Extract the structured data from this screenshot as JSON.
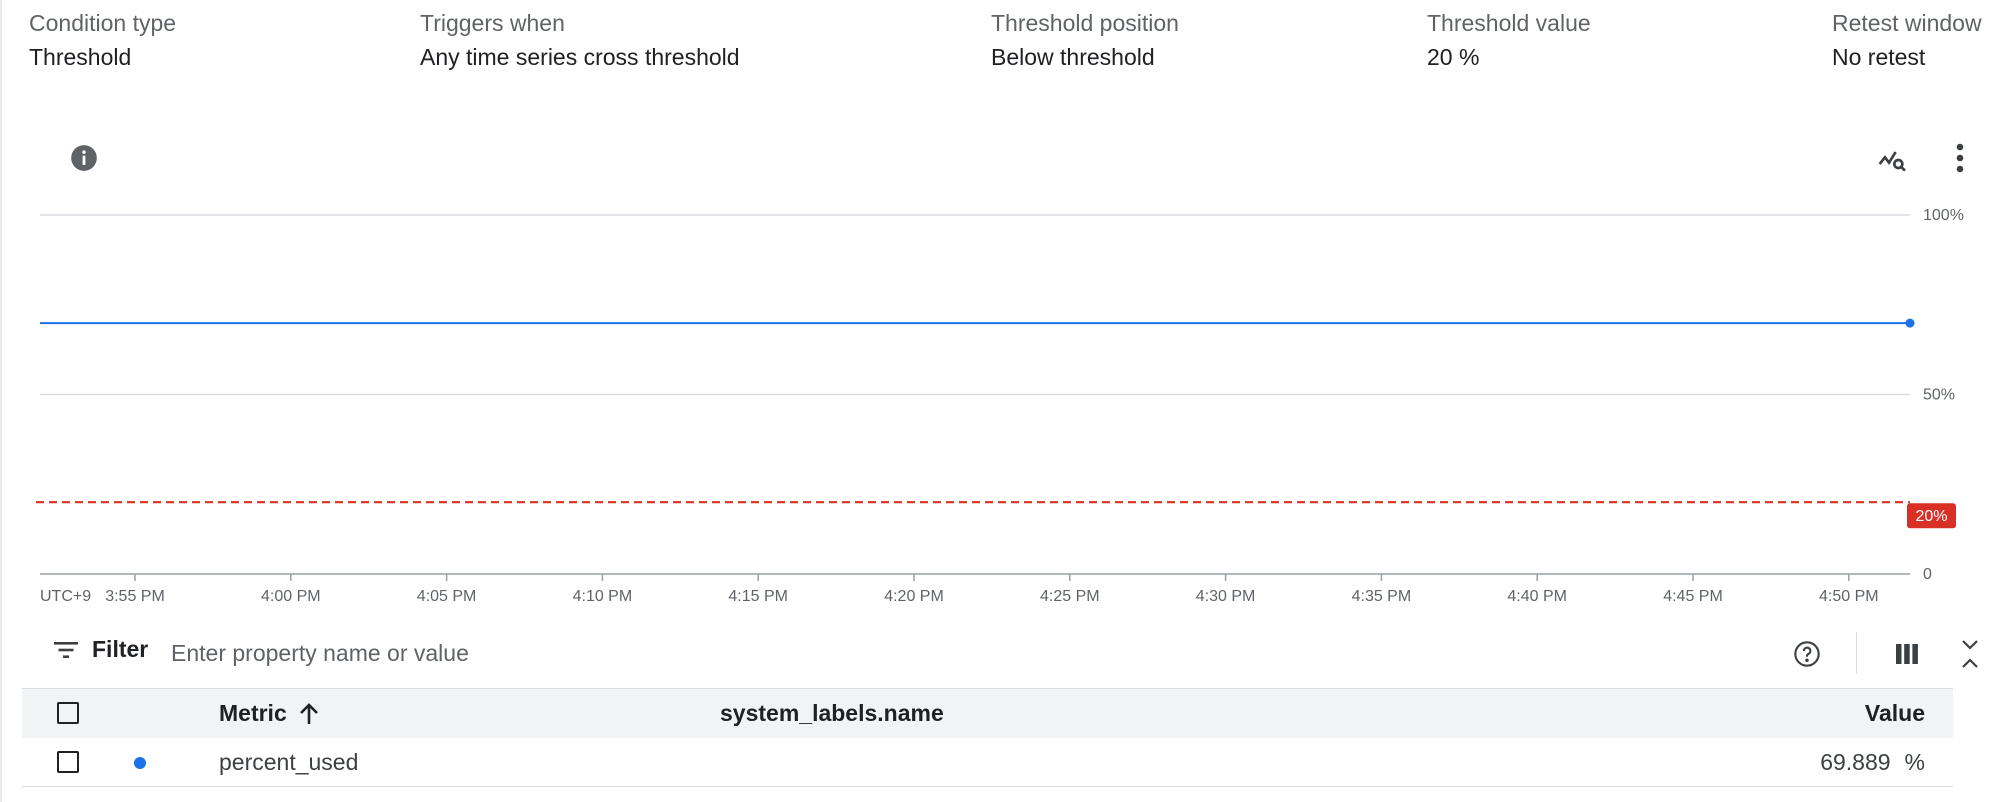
{
  "summary": [
    {
      "label": "Condition type",
      "value": "Threshold"
    },
    {
      "label": "Triggers when",
      "value": "Any time series cross threshold"
    },
    {
      "label": "Threshold position",
      "value": "Below threshold"
    },
    {
      "label": "Threshold value",
      "value": "20 %"
    },
    {
      "label": "Retest window",
      "value": "No retest"
    }
  ],
  "colors": {
    "series": "#1a73e8",
    "threshold": "#d93025",
    "grid": "#dadce0",
    "axis_text": "#5f6368"
  },
  "toolbar": {
    "info_icon": "info-icon",
    "explore_icon": "chart-search-icon",
    "more_icon": "more-vert-icon"
  },
  "chart_data": {
    "type": "line",
    "timezone_label": "UTC+9",
    "x": [
      "3:55 PM",
      "4:00 PM",
      "4:05 PM",
      "4:10 PM",
      "4:15 PM",
      "4:20 PM",
      "4:25 PM",
      "4:30 PM",
      "4:35 PM",
      "4:40 PM",
      "4:45 PM",
      "4:50 PM"
    ],
    "series": [
      {
        "name": "percent_used",
        "values": [
          69.889,
          69.889,
          69.889,
          69.889,
          69.889,
          69.889,
          69.889,
          69.889,
          69.889,
          69.889,
          69.889,
          69.889
        ]
      }
    ],
    "threshold": {
      "value": 20,
      "label": "20%"
    },
    "ylim": [
      0,
      100
    ],
    "yticks": [
      {
        "value": 0,
        "label": "0"
      },
      {
        "value": 50,
        "label": "50%"
      },
      {
        "value": 100,
        "label": "100%"
      }
    ],
    "grid": true
  },
  "filter": {
    "label": "Filter",
    "placeholder": "Enter property name or value",
    "help_icon": "help-icon",
    "columns_icon": "column-picker-icon",
    "collapse_icon": "collapse-icon"
  },
  "table": {
    "headers": {
      "metric": "Metric",
      "system_labels": "system_labels.name",
      "value": "Value"
    },
    "sort_icon": "arrow-up-icon",
    "rows": [
      {
        "metric": "percent_used",
        "system_labels": "",
        "value": "69.889",
        "unit": "%"
      }
    ]
  }
}
